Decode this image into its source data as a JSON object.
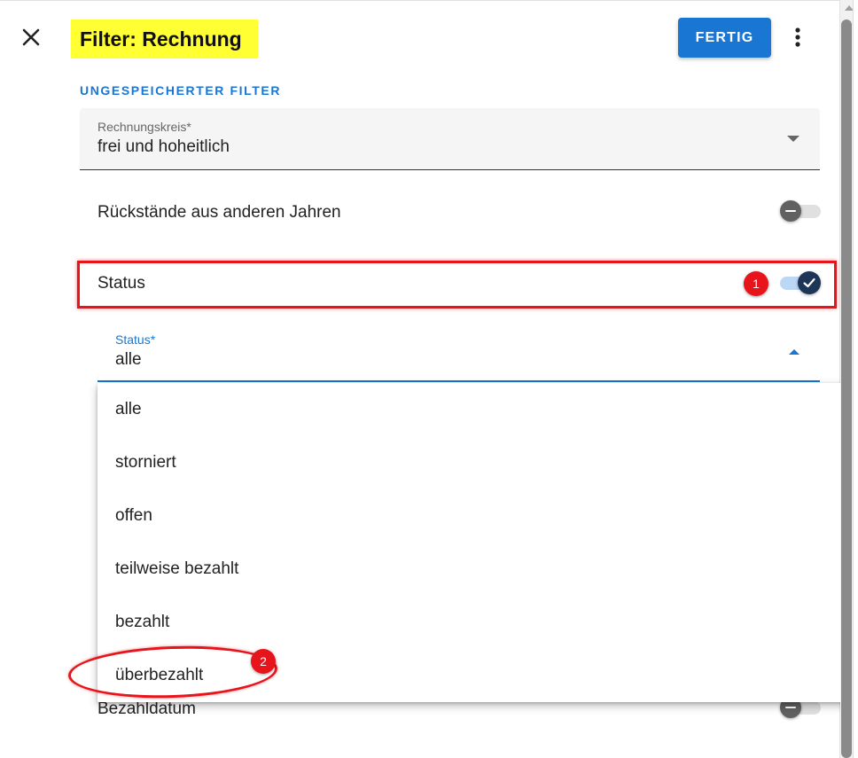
{
  "header": {
    "title": "Filter: Rechnung",
    "done_label": "FERTIG",
    "close_icon": "close-icon",
    "more_icon": "more-vert-icon"
  },
  "section": {
    "label": "UNGESPEICHERTER FILTER"
  },
  "rechnungskreis": {
    "label": "Rechnungskreis*",
    "value": "frei und hoheitlich"
  },
  "rueckstaende": {
    "label": "Rückstände aus anderen Jahren",
    "enabled": false
  },
  "status_toggle": {
    "label": "Status",
    "enabled": true
  },
  "status_select": {
    "label": "Status*",
    "value": "alle",
    "options": [
      "alle",
      "storniert",
      "offen",
      "teilweise bezahlt",
      "bezahlt",
      "überbezahlt"
    ]
  },
  "bezahldatum": {
    "label": "Bezahldatum",
    "enabled": false
  },
  "annotations": {
    "badge1": "1",
    "badge2": "2"
  },
  "colors": {
    "accent": "#1976d2",
    "highlight": "#ffff33",
    "annotation": "#e8141b",
    "toggle_on": "#1d3557"
  }
}
